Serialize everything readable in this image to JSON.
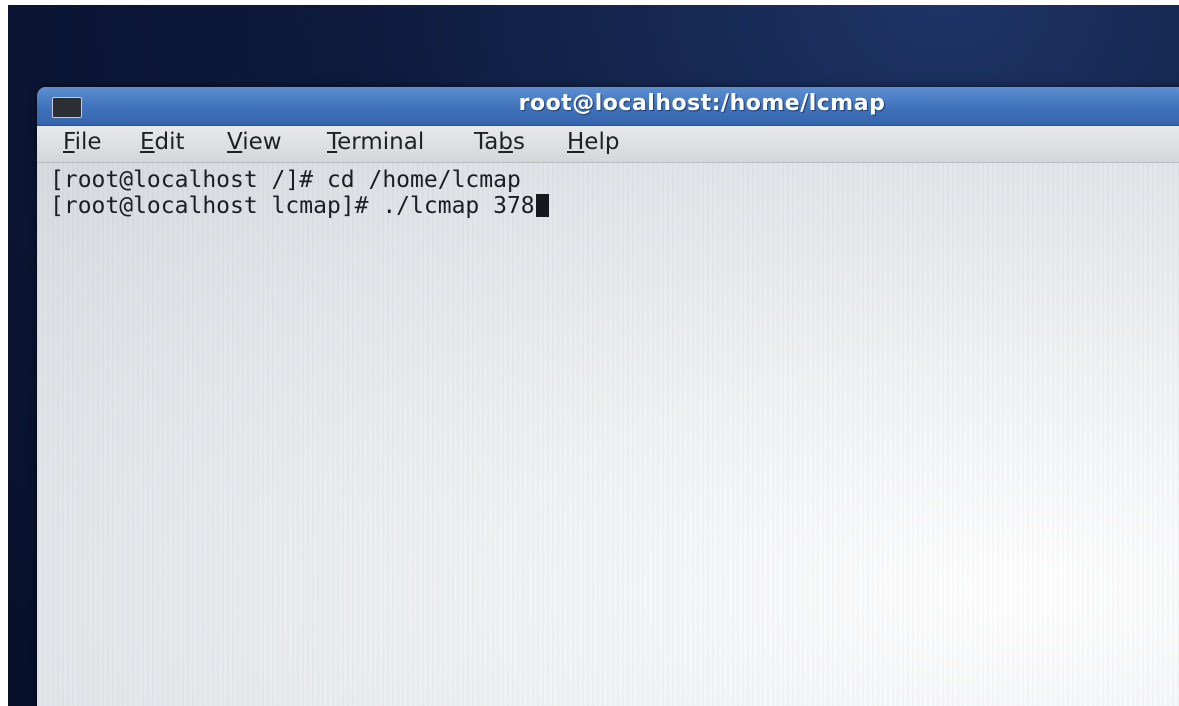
{
  "window": {
    "title": "root@localhost:/home/lcmap"
  },
  "menu": {
    "items": [
      {
        "mnemonic": "F",
        "rest": "ile"
      },
      {
        "mnemonic": "E",
        "rest": "dit"
      },
      {
        "mnemonic": "V",
        "rest": "iew"
      },
      {
        "mnemonic": "T",
        "rest": "erminal"
      },
      {
        "pre": "Ta",
        "mnemonic": "b",
        "rest": "s"
      },
      {
        "mnemonic": "H",
        "rest": "elp"
      }
    ]
  },
  "terminal": {
    "lines": [
      "[root@localhost /]# cd /home/lcmap",
      "[root@localhost lcmap]# ./lcmap 378"
    ]
  },
  "colors": {
    "titlebar": "#3f72bb",
    "title_text": "#ffffff",
    "terminal_bg": "#e9ecef",
    "terminal_text": "#1b1f24",
    "desktop": "#0d1a3c"
  },
  "icons": {
    "window_menu": "terminal-icon"
  }
}
